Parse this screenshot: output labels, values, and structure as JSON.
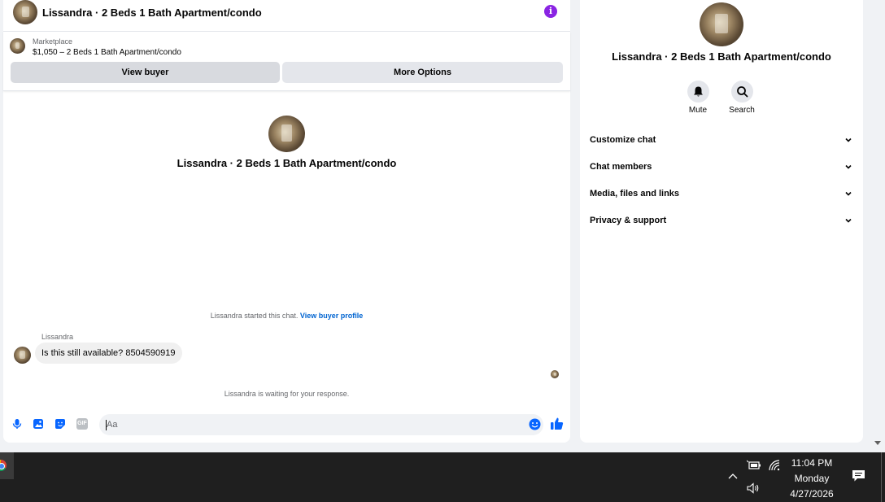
{
  "chat": {
    "header_title": "Lissandra · 2 Beds 1 Bath Apartment/condo",
    "listing_source": "Marketplace",
    "listing_price": "$1,050 – 2 Beds 1 Bath Apartment/condo",
    "view_buyer_label": "View buyer",
    "more_options_label": "More Options",
    "center_title": "Lissandra · 2 Beds 1 Bath Apartment/condo",
    "system_text": "Lissandra started this chat.",
    "system_link": "View buyer profile",
    "sender": "Lissandra",
    "message": "Is this still available? 8504590919",
    "waiting_text": "Lissandra is waiting for your response.",
    "composer_placeholder": "Aa",
    "gif_label": "GIF"
  },
  "info_panel": {
    "title": "Lissandra · 2 Beds 1 Bath Apartment/condo",
    "mute_label": "Mute",
    "search_label": "Search",
    "sections": [
      "Customize chat",
      "Chat members",
      "Media, files and links",
      "Privacy & support"
    ]
  },
  "taskbar": {
    "time": "11:04 PM",
    "day": "Monday",
    "date": "4/27/2026"
  },
  "colors": {
    "accent_blue": "#0866ff",
    "info_purple": "#8a24e3",
    "link_blue": "#0064d1"
  }
}
